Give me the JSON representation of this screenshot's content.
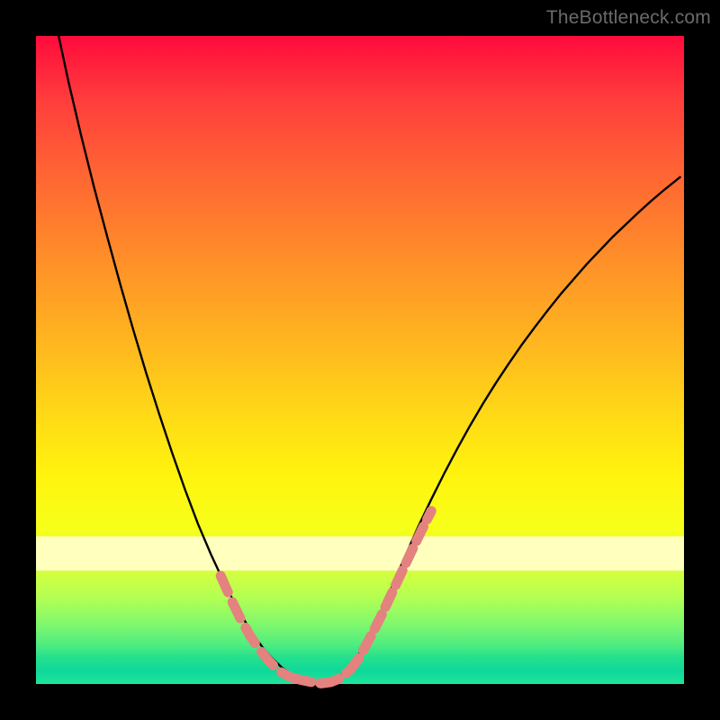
{
  "watermark": "TheBottleneck.com",
  "chart_data": {
    "type": "line",
    "title": "",
    "xlabel": "",
    "ylabel": "",
    "xlim": [
      0,
      1
    ],
    "ylim": [
      0,
      1
    ],
    "series": [
      {
        "name": "curve",
        "color": "#000000",
        "stroke_width": 2.4,
        "x": [
          0.035,
          0.05,
          0.07,
          0.09,
          0.11,
          0.13,
          0.15,
          0.17,
          0.19,
          0.21,
          0.23,
          0.25,
          0.27,
          0.29,
          0.31,
          0.33,
          0.35,
          0.365,
          0.38,
          0.395,
          0.41,
          0.425,
          0.44,
          0.455,
          0.47,
          0.49,
          0.51,
          0.53,
          0.55,
          0.57,
          0.59,
          0.61,
          0.63,
          0.65,
          0.67,
          0.69,
          0.71,
          0.73,
          0.75,
          0.77,
          0.79,
          0.81,
          0.83,
          0.85,
          0.87,
          0.89,
          0.91,
          0.93,
          0.95,
          0.97,
          0.985,
          0.995
        ],
        "y": [
          0.0,
          0.07,
          0.155,
          0.235,
          0.31,
          0.383,
          0.453,
          0.52,
          0.583,
          0.643,
          0.7,
          0.753,
          0.8,
          0.843,
          0.882,
          0.916,
          0.944,
          0.961,
          0.975,
          0.985,
          0.993,
          0.997,
          0.999,
          0.997,
          0.988,
          0.967,
          0.935,
          0.894,
          0.848,
          0.802,
          0.757,
          0.715,
          0.675,
          0.637,
          0.601,
          0.567,
          0.535,
          0.505,
          0.476,
          0.449,
          0.423,
          0.398,
          0.375,
          0.352,
          0.331,
          0.31,
          0.291,
          0.272,
          0.254,
          0.237,
          0.225,
          0.217
        ]
      },
      {
        "name": "pink-markers-left",
        "color": "#e3827f",
        "stroke_width": 11,
        "linecap": "round",
        "dash": "20 12",
        "x": [
          0.285,
          0.3,
          0.315,
          0.33,
          0.345,
          0.36,
          0.375,
          0.39
        ],
        "y": [
          0.833,
          0.867,
          0.898,
          0.925,
          0.947,
          0.965,
          0.98,
          0.988
        ]
      },
      {
        "name": "pink-markers-bottom",
        "color": "#e3827f",
        "stroke_width": 11,
        "linecap": "round",
        "dash": "22 10",
        "x": [
          0.395,
          0.41,
          0.425,
          0.44,
          0.455,
          0.47,
          0.485,
          0.5
        ],
        "y": [
          0.99,
          0.994,
          0.997,
          0.999,
          0.997,
          0.991,
          0.978,
          0.958
        ]
      },
      {
        "name": "pink-markers-right",
        "color": "#e3827f",
        "stroke_width": 11,
        "linecap": "round",
        "dash": "18 9",
        "x": [
          0.505,
          0.52,
          0.535,
          0.55,
          0.565,
          0.58,
          0.595,
          0.61
        ],
        "y": [
          0.948,
          0.92,
          0.89,
          0.858,
          0.826,
          0.794,
          0.763,
          0.733
        ]
      }
    ],
    "band": {
      "y0": 0.772,
      "y1": 0.825,
      "color": "#ffffbe"
    }
  }
}
